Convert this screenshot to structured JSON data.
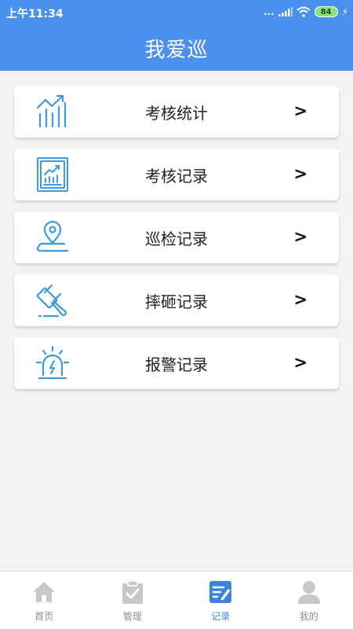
{
  "status_bar": {
    "time": "上午11:34",
    "signal_dots": "...",
    "battery": "84"
  },
  "header": {
    "title": "我爱巡"
  },
  "menu": [
    {
      "label": "考核统计",
      "arrow": ">",
      "icon": "chart-growth-icon"
    },
    {
      "label": "考核记录",
      "arrow": ">",
      "icon": "report-chart-icon"
    },
    {
      "label": "巡检记录",
      "arrow": ">",
      "icon": "location-pin-icon"
    },
    {
      "label": "摔砸记录",
      "arrow": ">",
      "icon": "gavel-icon"
    },
    {
      "label": "报警记录",
      "arrow": ">",
      "icon": "alarm-light-icon"
    }
  ],
  "tabbar": [
    {
      "label": "首页",
      "icon": "home-icon",
      "active": false
    },
    {
      "label": "管理",
      "icon": "clipboard-check-icon",
      "active": false
    },
    {
      "label": "记录",
      "icon": "edit-note-icon",
      "active": true
    },
    {
      "label": "我的",
      "icon": "user-icon",
      "active": false
    }
  ],
  "colors": {
    "header": "#4a90ed",
    "icon_blue": "#3a9be0",
    "tab_inactive": "#c8c8c8",
    "tab_active": "#3b86dc"
  }
}
